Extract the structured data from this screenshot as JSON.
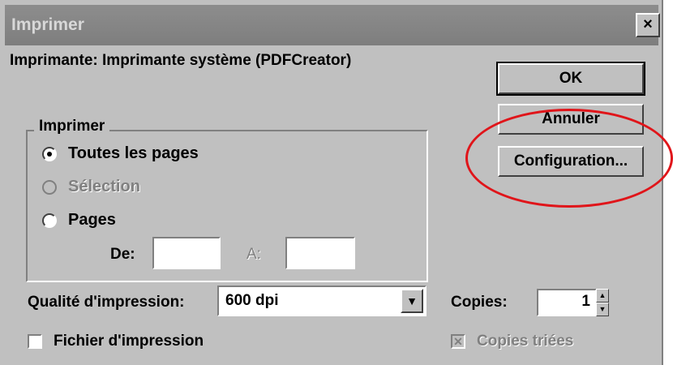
{
  "window": {
    "title": "Imprimer",
    "close_label": "×"
  },
  "printer": {
    "label": "Imprimante: Imprimante système (PDFCreator)"
  },
  "buttons": {
    "ok": "OK",
    "cancel": "Annuler",
    "config": "Configuration..."
  },
  "print_group": {
    "legend": "Imprimer",
    "all_pages": "Toutes les pages",
    "selection": "Sélection",
    "pages": "Pages",
    "from_label": "De:",
    "to_label": "A:",
    "from_value": "",
    "to_value": ""
  },
  "quality": {
    "label": "Qualité d'impression:",
    "value": "600 dpi"
  },
  "copies": {
    "label": "Copies:",
    "value": "1",
    "collate_label": "Copies triées"
  },
  "print_to_file": {
    "label": "Fichier d'impression"
  },
  "annotation": {
    "color": "#e0151a"
  }
}
